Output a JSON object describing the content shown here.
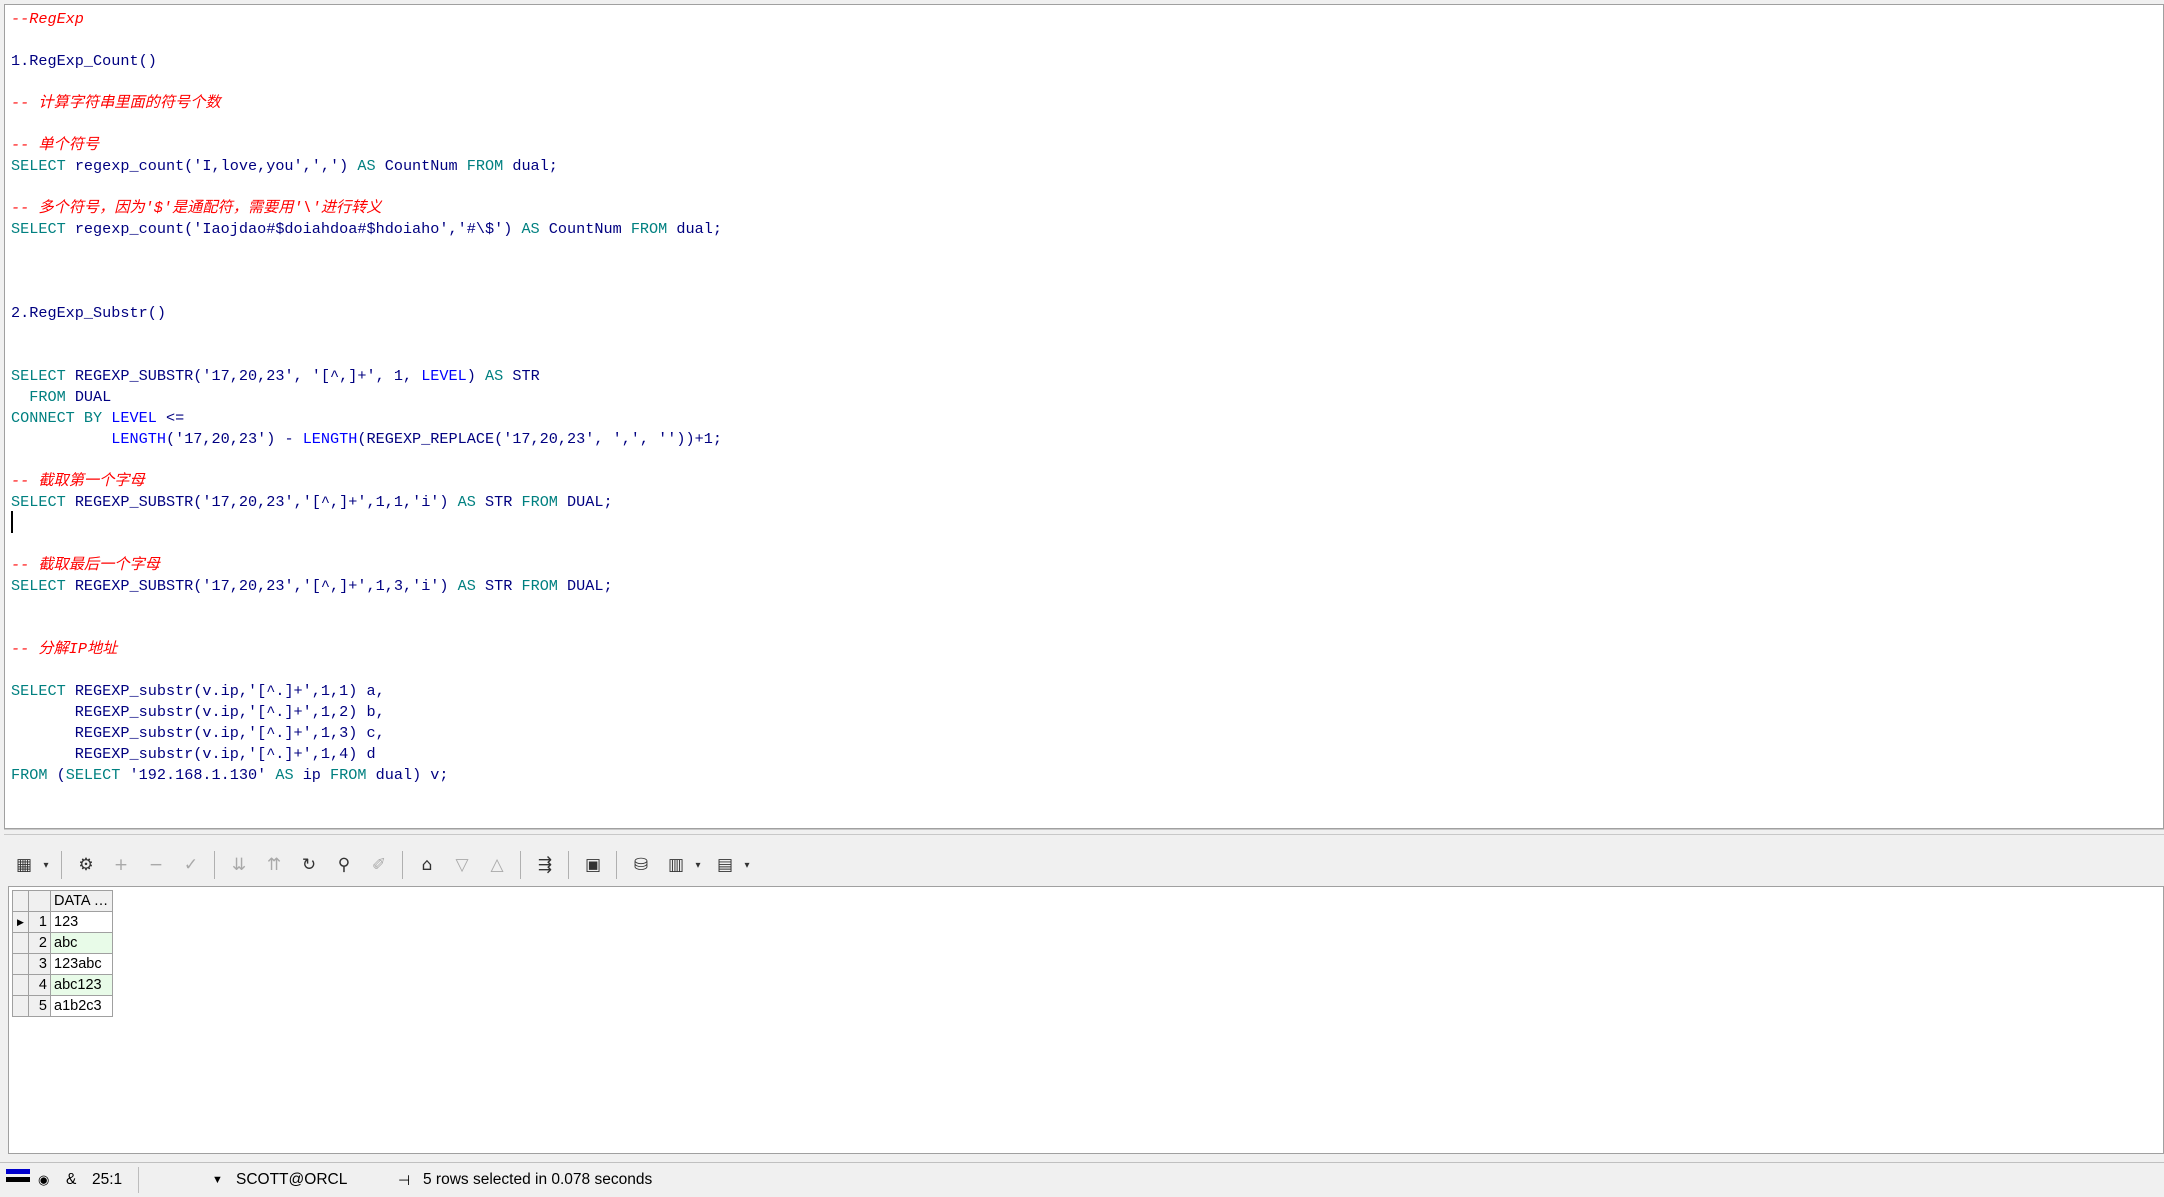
{
  "editor": {
    "lines": [
      [
        [
          "c",
          "--RegExp"
        ]
      ],
      [],
      [
        [
          "p",
          "1.RegExp_Count()"
        ]
      ],
      [],
      [
        [
          "c",
          "-- 计算字符串里面的符号个数"
        ]
      ],
      [],
      [
        [
          "c",
          "-- 单个符号"
        ]
      ],
      [
        [
          "k",
          "SELECT "
        ],
        [
          "p",
          "regexp_count("
        ],
        [
          "s",
          "'I,love,you'"
        ],
        [
          "p",
          ","
        ],
        [
          "s",
          "','"
        ],
        [
          "p",
          ") "
        ],
        [
          "k",
          "AS "
        ],
        [
          "p",
          "CountNum "
        ],
        [
          "k",
          "FROM "
        ],
        [
          "p",
          "dual;"
        ]
      ],
      [],
      [
        [
          "c",
          "-- 多个符号，因为'$'是通配符，需要用'\\'进行转义"
        ]
      ],
      [
        [
          "k",
          "SELECT "
        ],
        [
          "p",
          "regexp_count("
        ],
        [
          "s",
          "'Iaojdao#$doiahdoa#$hdoiaho'"
        ],
        [
          "p",
          ","
        ],
        [
          "s",
          "'#\\$'"
        ],
        [
          "p",
          ") "
        ],
        [
          "k",
          "AS "
        ],
        [
          "p",
          "CountNum "
        ],
        [
          "k",
          "FROM "
        ],
        [
          "p",
          "dual;"
        ]
      ],
      [],
      [],
      [],
      [
        [
          "p",
          "2.RegExp_Substr()"
        ]
      ],
      [],
      [],
      [
        [
          "k",
          "SELECT "
        ],
        [
          "p",
          "REGEXP_SUBSTR("
        ],
        [
          "s",
          "'17,20,23'"
        ],
        [
          "p",
          ", "
        ],
        [
          "s",
          "'[^,]+'"
        ],
        [
          "p",
          ", 1, "
        ],
        [
          "f",
          "LEVEL"
        ],
        [
          "p",
          ") "
        ],
        [
          "k",
          "AS "
        ],
        [
          "p",
          "STR"
        ]
      ],
      [
        [
          "k",
          "  FROM "
        ],
        [
          "p",
          "DUAL"
        ]
      ],
      [
        [
          "k",
          "CONNECT BY "
        ],
        [
          "f",
          "LEVEL "
        ],
        [
          "p",
          "<="
        ]
      ],
      [
        [
          "p",
          "           "
        ],
        [
          "f",
          "LENGTH"
        ],
        [
          "p",
          "("
        ],
        [
          "s",
          "'17,20,23'"
        ],
        [
          "p",
          ") - "
        ],
        [
          "f",
          "LENGTH"
        ],
        [
          "p",
          "(REGEXP_REPLACE("
        ],
        [
          "s",
          "'17,20,23'"
        ],
        [
          "p",
          ", "
        ],
        [
          "s",
          "','"
        ],
        [
          "p",
          ", "
        ],
        [
          "s",
          "''"
        ],
        [
          "p",
          "))+1;"
        ]
      ],
      [],
      [
        [
          "c",
          "-- 截取第一个字母"
        ]
      ],
      [
        [
          "k",
          "SELECT "
        ],
        [
          "p",
          "REGEXP_SUBSTR("
        ],
        [
          "s",
          "'17,20,23'"
        ],
        [
          "p",
          ","
        ],
        [
          "s",
          "'[^,]+'"
        ],
        [
          "p",
          ",1,1,"
        ],
        [
          "s",
          "'i'"
        ],
        [
          "p",
          ") "
        ],
        [
          "k",
          "AS "
        ],
        [
          "p",
          "STR "
        ],
        [
          "k",
          "FROM "
        ],
        [
          "p",
          "DUAL;"
        ]
      ],
      [],
      [],
      [
        [
          "c",
          "-- 截取最后一个字母"
        ]
      ],
      [
        [
          "k",
          "SELECT "
        ],
        [
          "p",
          "REGEXP_SUBSTR("
        ],
        [
          "s",
          "'17,20,23'"
        ],
        [
          "p",
          ","
        ],
        [
          "s",
          "'[^,]+'"
        ],
        [
          "p",
          ",1,3,"
        ],
        [
          "s",
          "'i'"
        ],
        [
          "p",
          ") "
        ],
        [
          "k",
          "AS "
        ],
        [
          "p",
          "STR "
        ],
        [
          "k",
          "FROM "
        ],
        [
          "p",
          "DUAL;"
        ]
      ],
      [],
      [],
      [
        [
          "c",
          "-- 分解IP地址"
        ]
      ],
      [],
      [
        [
          "k",
          "SELECT "
        ],
        [
          "p",
          "REGEXP_substr(v.ip,"
        ],
        [
          "s",
          "'[^.]+'"
        ],
        [
          "p",
          ",1,1) a,"
        ]
      ],
      [
        [
          "p",
          "       REGEXP_substr(v.ip,"
        ],
        [
          "s",
          "'[^.]+'"
        ],
        [
          "p",
          ",1,2) b,"
        ]
      ],
      [
        [
          "p",
          "       REGEXP_substr(v.ip,"
        ],
        [
          "s",
          "'[^.]+'"
        ],
        [
          "p",
          ",1,3) c,"
        ]
      ],
      [
        [
          "p",
          "       REGEXP_substr(v.ip,"
        ],
        [
          "s",
          "'[^.]+'"
        ],
        [
          "p",
          ",1,4) d"
        ]
      ],
      [
        [
          "k",
          "FROM "
        ],
        [
          "p",
          "("
        ],
        [
          "k",
          "SELECT "
        ],
        [
          "s",
          "'192.168.1.130' "
        ],
        [
          "k",
          "AS "
        ],
        [
          "p",
          "ip "
        ],
        [
          "k",
          "FROM "
        ],
        [
          "p",
          "dual) v;"
        ]
      ]
    ]
  },
  "toolbar": {
    "icons": [
      "grid-icon",
      "dropdown-arrow-icon",
      "query-icon",
      "plus-icon",
      "minus-icon",
      "check-icon",
      "double-down-icon",
      "double-up-icon",
      "refresh-icon",
      "binoculars-icon",
      "eraser-icon",
      "export-icon",
      "down-arrow-icon",
      "up-arrow-icon",
      "connect-icon",
      "save-icon",
      "database-icon",
      "chart-icon",
      "dropdown-arrow-icon",
      "table-icon",
      "dropdown-arrow-icon"
    ]
  },
  "results": {
    "column": "DATA",
    "rows": [
      {
        "num": "1",
        "value": "123"
      },
      {
        "num": "2",
        "value": "abc"
      },
      {
        "num": "3",
        "value": "123abc"
      },
      {
        "num": "4",
        "value": "abc123"
      },
      {
        "num": "5",
        "value": "a1b2c3"
      }
    ]
  },
  "status": {
    "cursor_pos": "25:1",
    "connection": "SCOTT@ORCL",
    "message": "5 rows selected in 0.078 seconds"
  }
}
